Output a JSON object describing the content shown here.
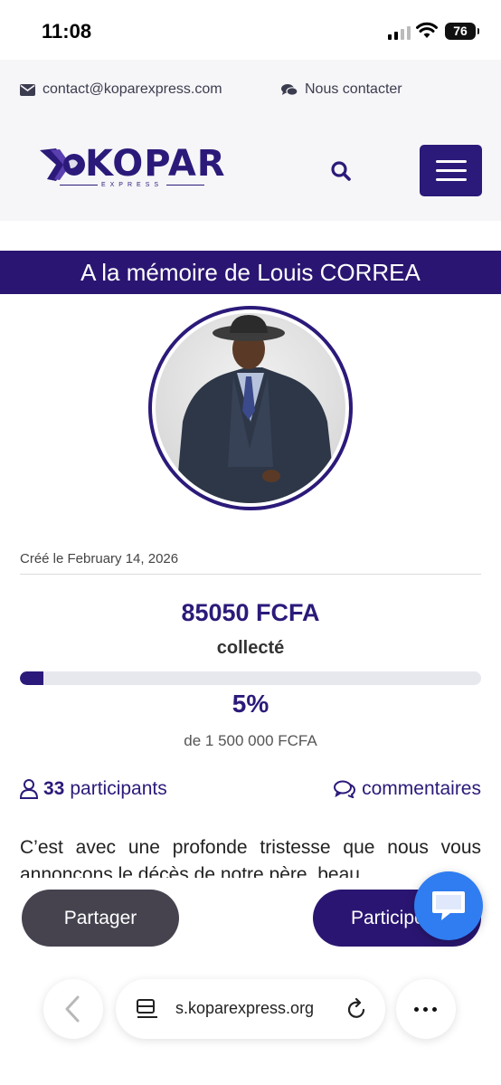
{
  "status_bar": {
    "time": "11:08",
    "battery": "76"
  },
  "header": {
    "email": "contact@koparexpress.com",
    "contact_label": "Nous contacter",
    "logo_text": "KOPAR",
    "logo_subtext": "EXPRESS",
    "icons": [
      "envelope-icon",
      "chat-bubbles-icon",
      "search-icon",
      "hamburger-menu-icon"
    ]
  },
  "campaign": {
    "title": "A la mémoire de Louis CORREA",
    "created_label": "Créé le February 14, 2026",
    "amount": "85050 FCFA",
    "collected_label": "collecté",
    "progress_fraction": 0.05,
    "percent_label": "5%",
    "goal_label": "de 1 500 000 FCFA",
    "participants_count": "33",
    "participants_label": "participants",
    "comments_label": "commentaires",
    "description": "C’est avec une profonde tristesse que nous vous annonçons le décès de notre père, beau"
  },
  "actions": {
    "share_label": "Partager",
    "participate_label": "Participer"
  },
  "browser": {
    "url": "s.koparexpress.org"
  },
  "colors": {
    "brand": "#2c1a7a",
    "banner": "#2a1672",
    "share_button": "#46434f",
    "chat_fab": "#2f7df0"
  }
}
